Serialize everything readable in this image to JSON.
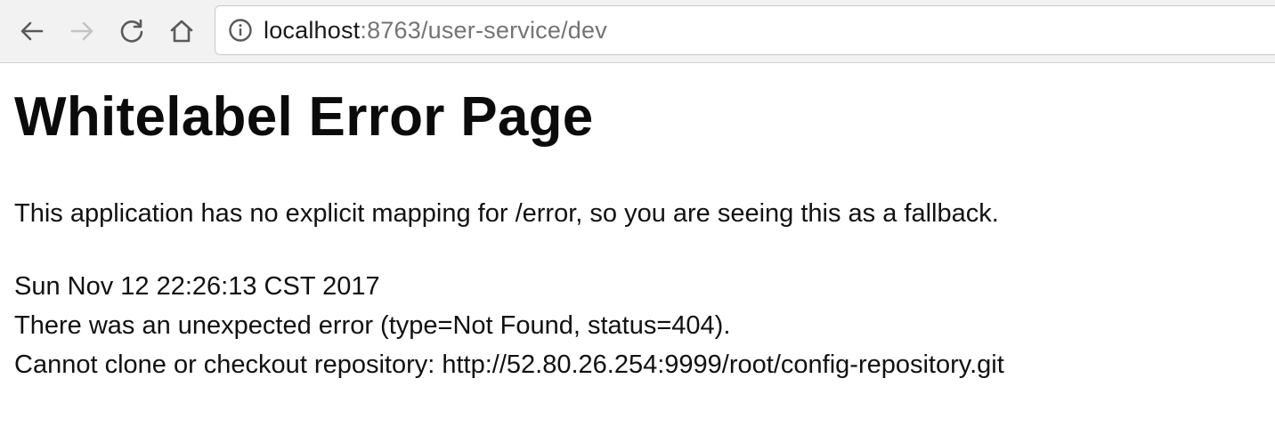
{
  "browser": {
    "url_host": "localhost",
    "url_rest": ":8763/user-service/dev",
    "icons": {
      "back": "back-arrow-icon",
      "forward": "forward-arrow-icon",
      "reload": "reload-icon",
      "home": "home-icon",
      "info": "info-icon"
    }
  },
  "page": {
    "title": "Whitelabel Error Page",
    "message": "This application has no explicit mapping for /error, so you are seeing this as a fallback.",
    "timestamp": "Sun Nov 12 22:26:13 CST 2017",
    "error_line": "There was an unexpected error (type=Not Found, status=404).",
    "detail_line": "Cannot clone or checkout repository: http://52.80.26.254:9999/root/config-repository.git"
  },
  "colors": {
    "toolbar_bg": "#f2f2f2",
    "url_host": "#1a1a1a",
    "url_path": "#747474",
    "icon_active": "#5a5a5a",
    "icon_disabled": "#c4c4c4"
  }
}
